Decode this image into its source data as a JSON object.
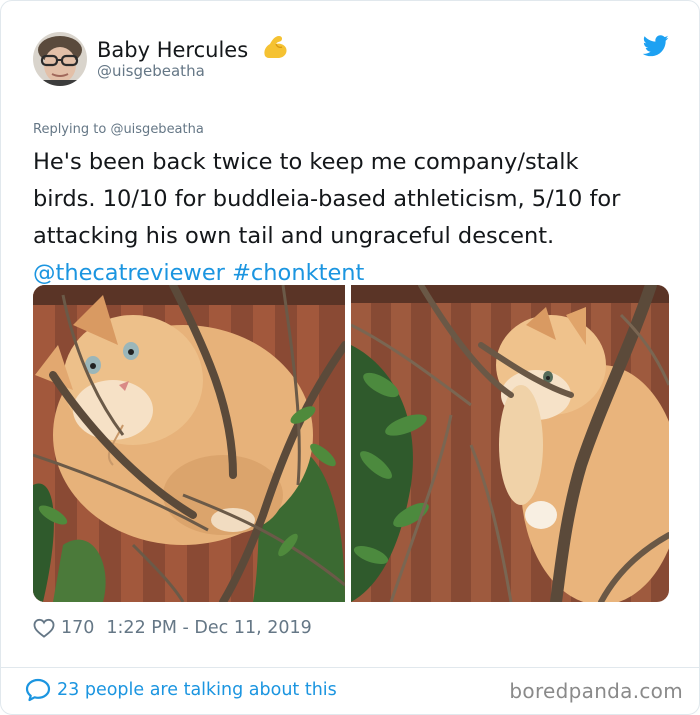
{
  "author": {
    "display_name": "Baby Hercules",
    "handle": "@uisgebeatha",
    "emoji": "flexed-biceps-emoji"
  },
  "reply": {
    "prefix": "Replying to",
    "target": "@uisgebeatha"
  },
  "tweet": {
    "line1": "He's been back twice to keep me company/stalk",
    "line2": "birds. 10/10 for buddleia-based athleticism, 5/10 for",
    "line3": "attacking his own tail and ungraceful descent.",
    "mention": "@thecatreviewer",
    "hashtag": "#chonktent"
  },
  "stats": {
    "likes": "170",
    "time": "1:22 PM",
    "separator": "-",
    "date": "Dec 11, 2019"
  },
  "footer": {
    "talking": "23 people are talking about this",
    "watermark": "boredpanda.com"
  },
  "icons": {
    "brand": "twitter-bird-icon",
    "like": "heart-icon",
    "reply": "speech-bubble-icon"
  },
  "colors": {
    "link": "#1b95e0",
    "text": "#14171a",
    "muted": "#657786",
    "border": "#e1e8ed"
  }
}
